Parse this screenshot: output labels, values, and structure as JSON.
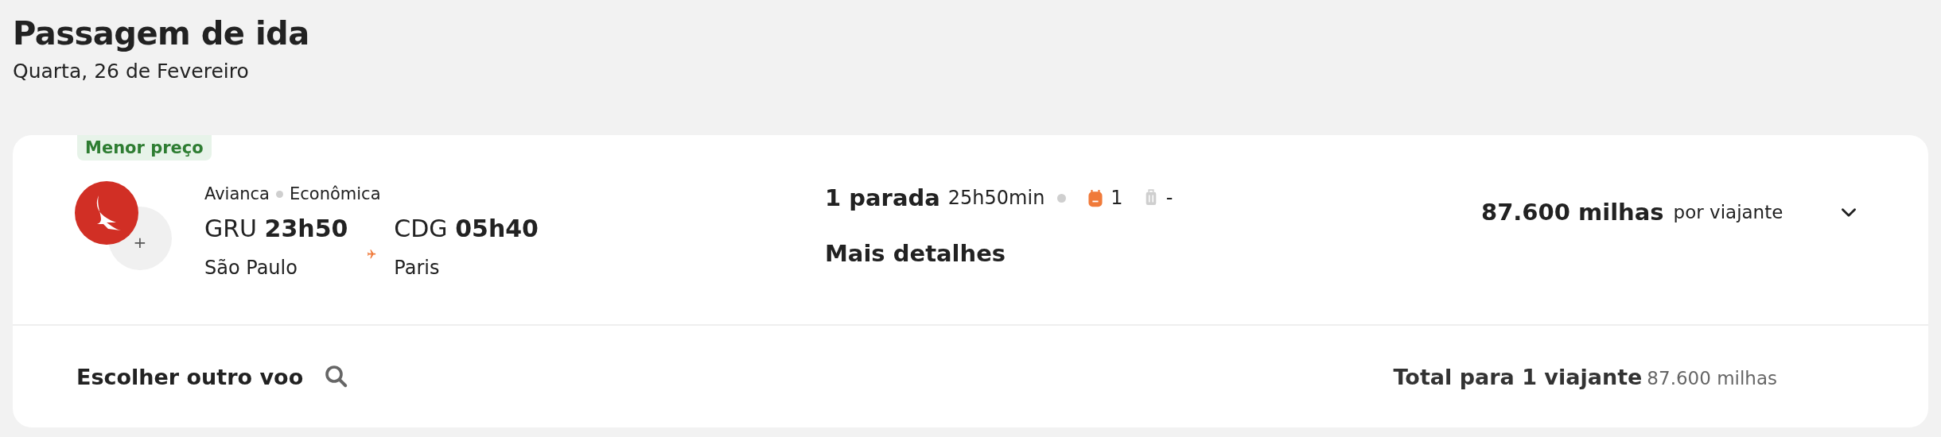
{
  "header": {
    "title": "Passagem de ida",
    "date": "Quarta, 26 de Fevereiro"
  },
  "offer": {
    "badge": "Menor preço",
    "airline": "Avianca",
    "cabin": "Econômica",
    "extra_carriers": "+",
    "departure": {
      "code": "GRU",
      "time": "23h50",
      "city": "São Paulo"
    },
    "arrival": {
      "code": "CDG",
      "time": "05h40",
      "city": "Paris"
    },
    "stops": "1 parada",
    "duration": "25h50min",
    "baggage": [
      {
        "kind": "backpack",
        "included": true,
        "count": "1"
      },
      {
        "kind": "suitcase",
        "included": false,
        "count": "-"
      }
    ],
    "details_link": "Mais detalhes",
    "price": "87.600 milhas",
    "price_unit": "por viajante",
    "expanded": false
  },
  "footer": {
    "choose_other": "Escolher outro voo",
    "total_label": "Total para 1 viajante",
    "total_value": "87.600 milhas"
  }
}
